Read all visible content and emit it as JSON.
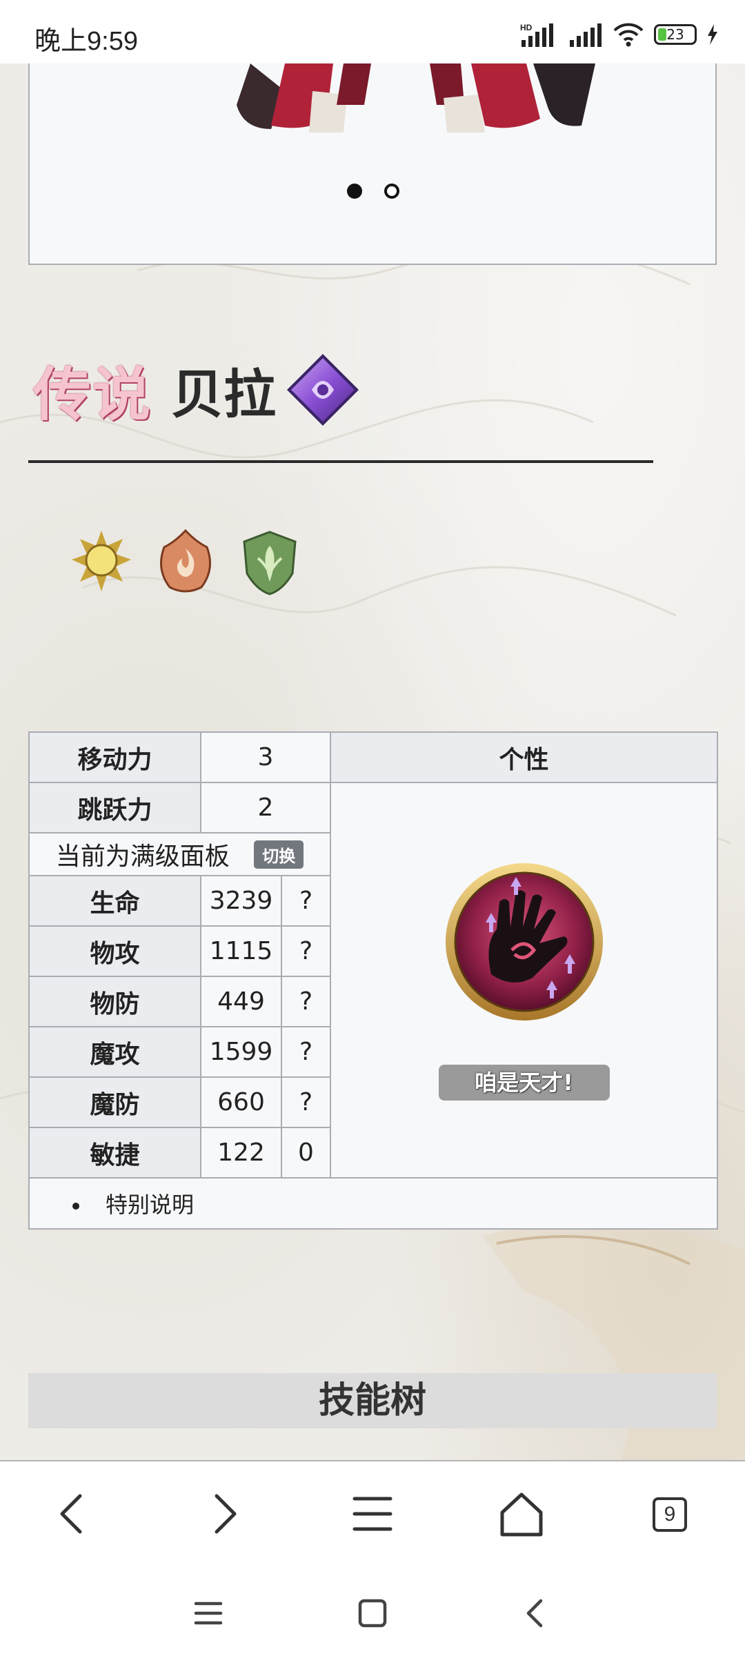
{
  "status_bar": {
    "time": "晚上9:59",
    "network_label": "HD",
    "battery_percent": "23",
    "battery_level": 0.23,
    "charging": true
  },
  "carousel": {
    "slide_count": 2,
    "active_index": 0
  },
  "character": {
    "rarity": "传说",
    "name": "贝拉",
    "element_icon": "purple-diamond-icon",
    "attribute_icons": [
      "sun-emblem-icon",
      "flame-emblem-icon",
      "leaf-emblem-icon"
    ]
  },
  "stats_table": {
    "move_label": "移动力",
    "move_value": "3",
    "jump_label": "跳跃力",
    "jump_value": "2",
    "trait_header": "个性",
    "panel_note": "当前为满级面板",
    "switch_label": "切换",
    "rows": [
      {
        "label": "生命",
        "value": "3239",
        "extra": "?"
      },
      {
        "label": "物攻",
        "value": "1115",
        "extra": "?"
      },
      {
        "label": "物防",
        "value": "449",
        "extra": "?"
      },
      {
        "label": "魔攻",
        "value": "1599",
        "extra": "?"
      },
      {
        "label": "魔防",
        "value": "660",
        "extra": "?"
      },
      {
        "label": "敏捷",
        "value": "122",
        "extra": "0"
      }
    ],
    "trait_icon": "hand-skill-icon",
    "trait_name": "咱是天才!",
    "special_note": "特别说明"
  },
  "section": {
    "skill_tree_title": "技能树"
  },
  "browser_toolbar": {
    "tabs_count": "9"
  },
  "colors": {
    "table_border": "#a9acb2",
    "header_bg": "#eaecf0",
    "switch_bg": "#72777d",
    "battery_green": "#58c341"
  }
}
